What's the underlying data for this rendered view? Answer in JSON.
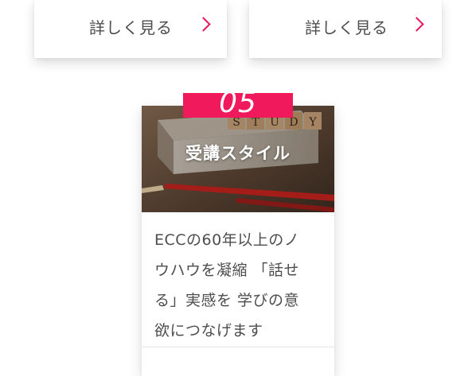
{
  "cards_top": {
    "left": {
      "more_label": "詳しく見る",
      "icon": "chevron-right-icon"
    },
    "right": {
      "more_label": "詳しく見る",
      "icon": "chevron-right-icon"
    }
  },
  "feature_card": {
    "number": "05",
    "title": "受講スタイル",
    "image_letters": [
      "S",
      "T",
      "U",
      "D",
      "Y"
    ],
    "description_lines": [
      "ECCの60年以上のノ",
      "ウハウを凝縮 「話せ",
      "る」実感を 学びの意",
      "欲につなげます"
    ]
  },
  "colors": {
    "accent": "#f0195b",
    "chevron": "#e8175d",
    "text": "#4d4d4d"
  }
}
